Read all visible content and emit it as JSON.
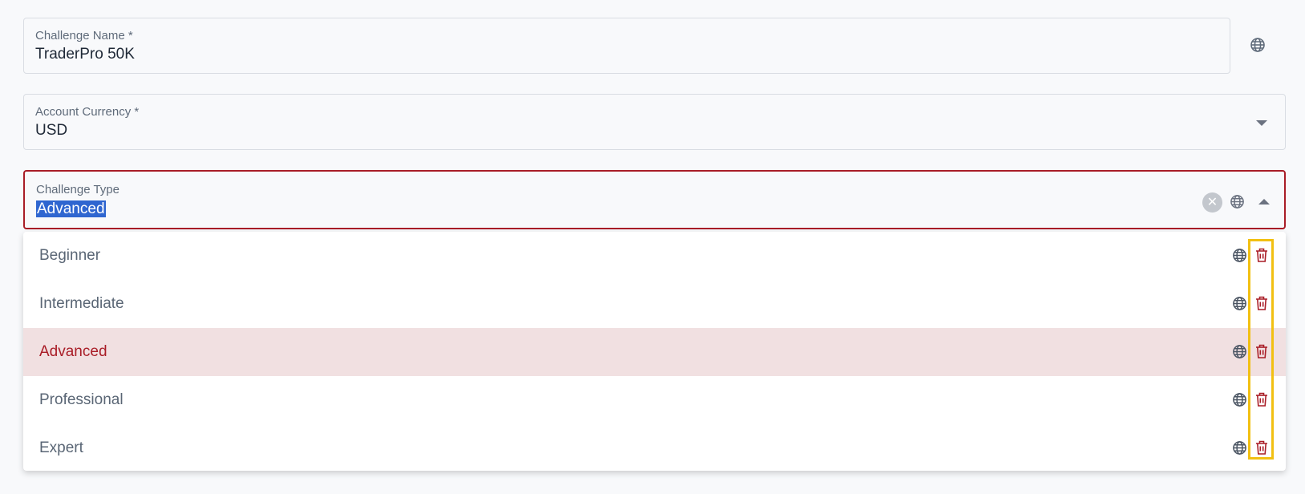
{
  "challenge_name": {
    "label": "Challenge Name *",
    "value": "TraderPro 50K",
    "icon": "globe-icon"
  },
  "account_currency": {
    "label": "Account Currency *",
    "value": "USD",
    "icon": "chevron-down-icon"
  },
  "challenge_type": {
    "label": "Challenge Type",
    "value": "Advanced",
    "icons": [
      "clear-icon",
      "globe-icon",
      "chevron-up-icon"
    ],
    "clear_glyph": "✕"
  },
  "dropdown": {
    "options": [
      {
        "label": "Beginner",
        "selected": false
      },
      {
        "label": "Intermediate",
        "selected": false
      },
      {
        "label": "Advanced",
        "selected": true
      },
      {
        "label": "Professional",
        "selected": false
      },
      {
        "label": "Expert",
        "selected": false
      }
    ],
    "option_icons": [
      "globe-icon",
      "trash-icon"
    ]
  },
  "colors": {
    "accent": "#a91d27",
    "selected_row_bg": "#f1e0e1",
    "text_selection": "#2f66d0",
    "highlight_box": "#f2c012"
  }
}
